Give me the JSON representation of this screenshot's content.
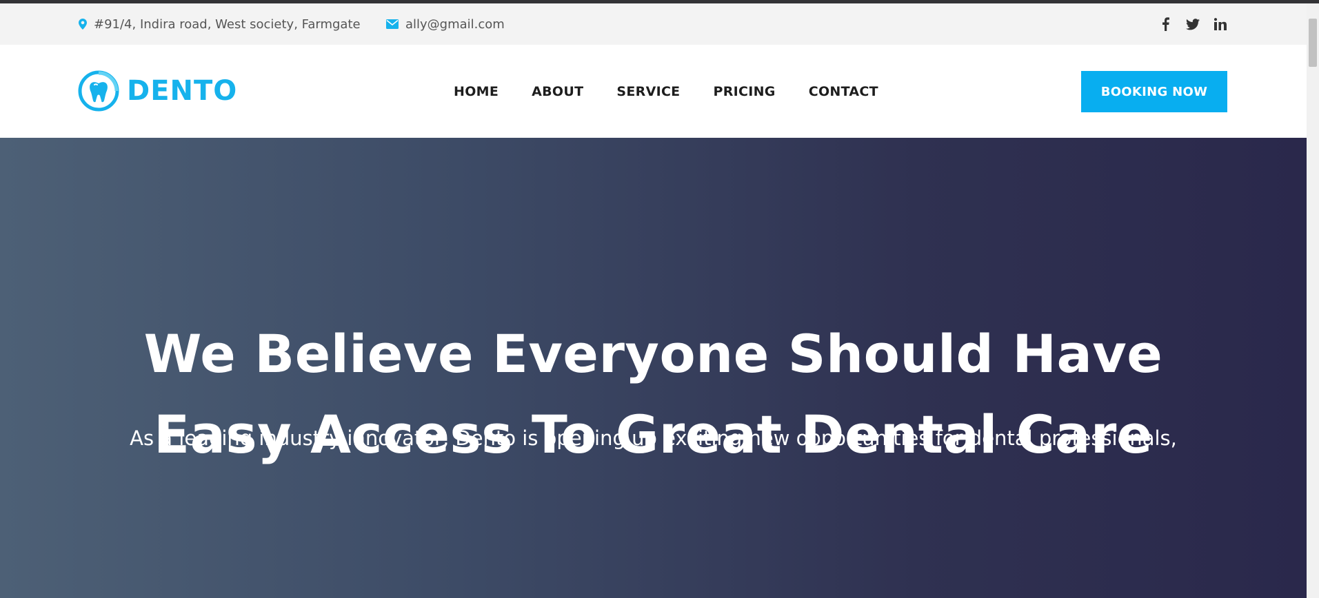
{
  "topbar": {
    "address": "#91/4, Indira road, West society, Farmgate",
    "email": "ally@gmail.com",
    "address_icon": "map-marker-icon",
    "email_icon": "envelope-icon",
    "social": [
      "facebook-icon",
      "twitter-icon",
      "linkedin-icon"
    ]
  },
  "header": {
    "logo_text": "DENTO",
    "logo_icon": "tooth-icon",
    "nav": [
      "HOME",
      "ABOUT",
      "SERVICE",
      "PRICING",
      "CONTACT"
    ],
    "booking_label": "BOOKING NOW"
  },
  "hero": {
    "title_line1": "We Believe Everyone Should Have",
    "title_line2": "Easy Access To Great Dental Care",
    "subtitle": "As a leading industry innovator, Dento is opening up exciting new opportunities for dental professionals,"
  },
  "colors": {
    "accent": "#08aef0",
    "logo": "#16b2ec",
    "topbar_bg": "#f3f3f3",
    "hero_gradient_start": "#4d6076",
    "hero_gradient_end": "#2a284b"
  }
}
